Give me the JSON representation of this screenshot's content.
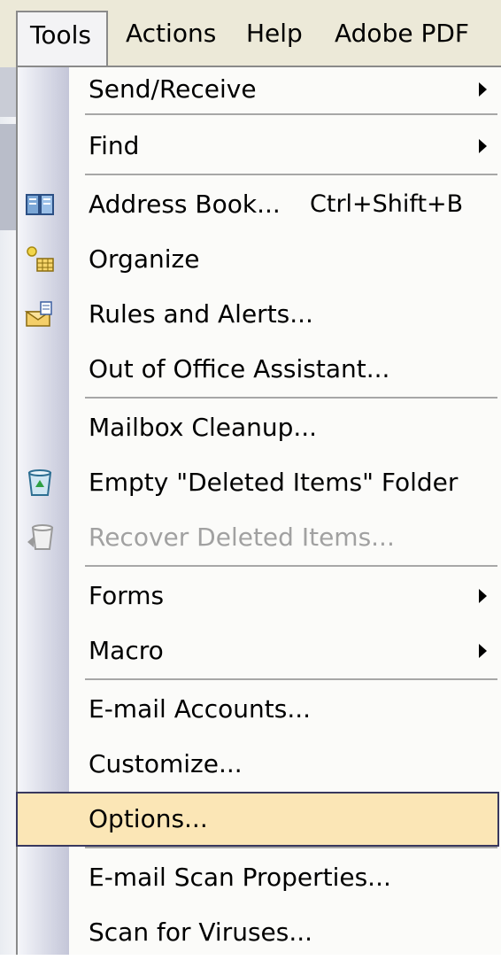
{
  "menubar": {
    "items": [
      {
        "label": "Tools",
        "open": true
      },
      {
        "label": "Actions"
      },
      {
        "label": "Help"
      },
      {
        "label": "Adobe PDF"
      }
    ]
  },
  "tools_menu": {
    "items": [
      {
        "label": "Send/Receive",
        "submenu": true
      },
      {
        "label": "Find",
        "submenu": true
      },
      {
        "label": "Address Book...",
        "shortcut": "Ctrl+Shift+B",
        "icon": "address-book-icon"
      },
      {
        "label": "Organize",
        "icon": "organize-icon"
      },
      {
        "label": "Rules and Alerts...",
        "icon": "rules-icon"
      },
      {
        "label": "Out of Office Assistant..."
      },
      {
        "label": "Mailbox Cleanup..."
      },
      {
        "label": "Empty \"Deleted Items\" Folder",
        "icon": "recycle-bin-icon"
      },
      {
        "label": "Recover Deleted Items...",
        "icon": "recover-items-icon",
        "disabled": true
      },
      {
        "label": "Forms",
        "submenu": true
      },
      {
        "label": "Macro",
        "submenu": true
      },
      {
        "label": "E-mail Accounts..."
      },
      {
        "label": "Customize..."
      },
      {
        "label": "Options...",
        "highlighted": true
      },
      {
        "label": "E-mail Scan Properties..."
      },
      {
        "label": "Scan for Viruses..."
      }
    ]
  },
  "colors": {
    "menubar_bg": "#ece9d8",
    "highlight_bg": "#fbe6b6",
    "highlight_border": "#38385e",
    "disabled_text": "#a1a1a1"
  }
}
